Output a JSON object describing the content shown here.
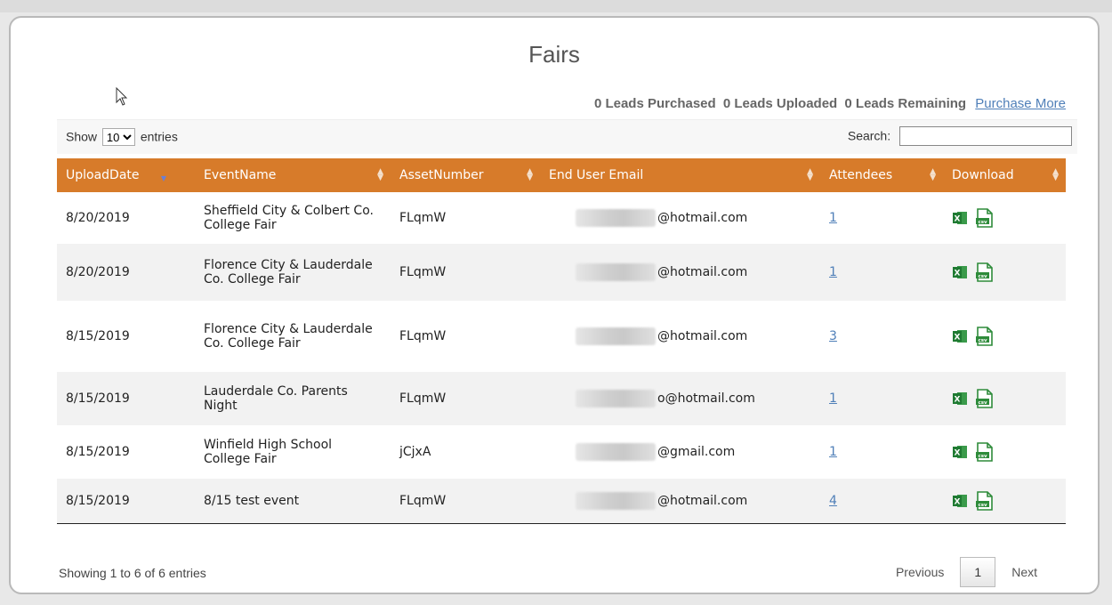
{
  "page": {
    "title": "Fairs",
    "leads": {
      "purchased": "0 Leads Purchased",
      "uploaded": "0 Leads Uploaded",
      "remaining": "0 Leads Remaining",
      "purchase_more": "Purchase More"
    }
  },
  "controls": {
    "show_label": "Show",
    "entries_value": "10",
    "entries_label": "entries",
    "search_label": "Search:",
    "search_value": ""
  },
  "table": {
    "headers": [
      "UploadDate",
      "EventName",
      "AssetNumber",
      "End User Email",
      "Attendees",
      "Download"
    ],
    "rows": [
      {
        "date": "8/20/2019",
        "event": "Sheffield City & Colbert Co. College Fair",
        "asset": "FLqmW",
        "email": "@hotmail.com",
        "attendees": "1"
      },
      {
        "date": "8/20/2019",
        "event": "Florence City & Lauderdale Co. College Fair",
        "asset": "FLqmW",
        "email": "@hotmail.com",
        "attendees": "1"
      },
      {
        "date": "8/15/2019",
        "event": "Florence City & Lauderdale Co. College Fair",
        "asset": "FLqmW",
        "email": "@hotmail.com",
        "attendees": "3"
      },
      {
        "date": "8/15/2019",
        "event": "Lauderdale Co. Parents Night",
        "asset": "FLqmW",
        "email": "o@hotmail.com",
        "attendees": "1"
      },
      {
        "date": "8/15/2019",
        "event": "Winfield High School College Fair",
        "asset": "jCjxA",
        "email": "@gmail.com",
        "attendees": "1"
      },
      {
        "date": "8/15/2019",
        "event": "8/15 test event",
        "asset": "FLqmW",
        "email": "@hotmail.com",
        "attendees": "4"
      }
    ]
  },
  "footer": {
    "info": "Showing 1 to 6 of 6 entries",
    "previous": "Previous",
    "page": "1",
    "next": "Next"
  },
  "icons": {
    "excel": "excel-icon",
    "csv": "csv-icon",
    "csv_text": "csv"
  },
  "colors": {
    "header": "#d77b2a",
    "link": "#4f7fb8",
    "icon_green": "#2e8b3a"
  }
}
